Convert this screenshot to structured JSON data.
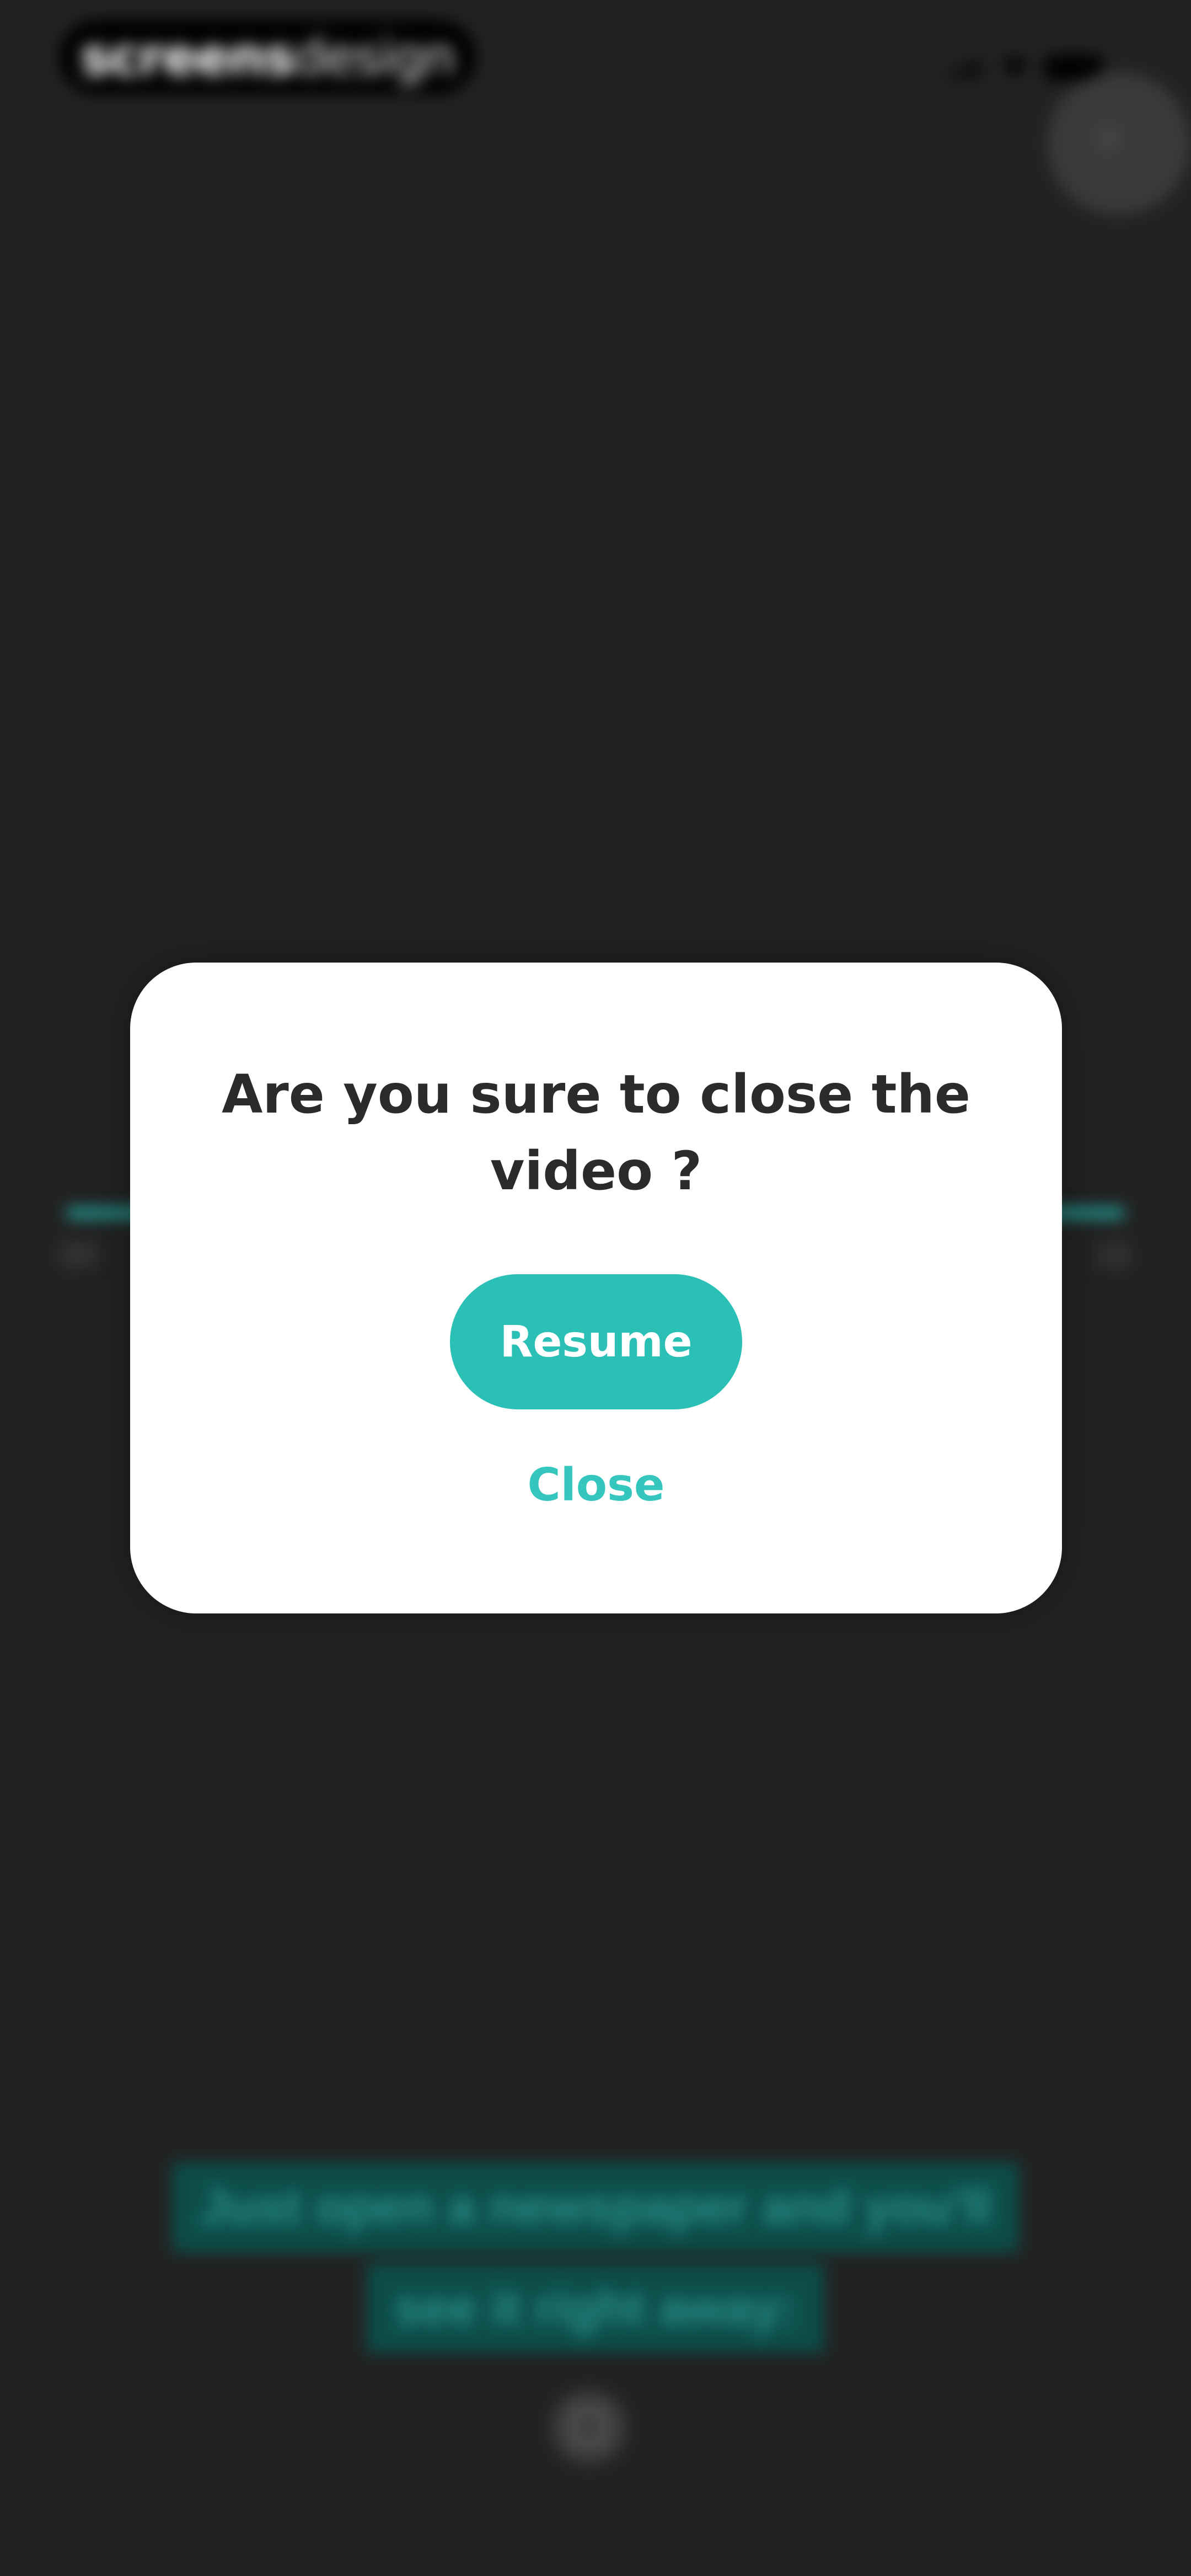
{
  "brand": {
    "bold": "screens",
    "light": "design"
  },
  "player": {
    "elapsed": "00",
    "remaining": "15"
  },
  "subtitle": {
    "line1": "Just open a newspaper and you'll",
    "line2": "see it right away:"
  },
  "dialog": {
    "title": "Are you sure to close the video ?",
    "resume_label": "Resume",
    "close_label": "Close"
  },
  "colors": {
    "accent": "#2bc0b6",
    "background": "#222222"
  }
}
